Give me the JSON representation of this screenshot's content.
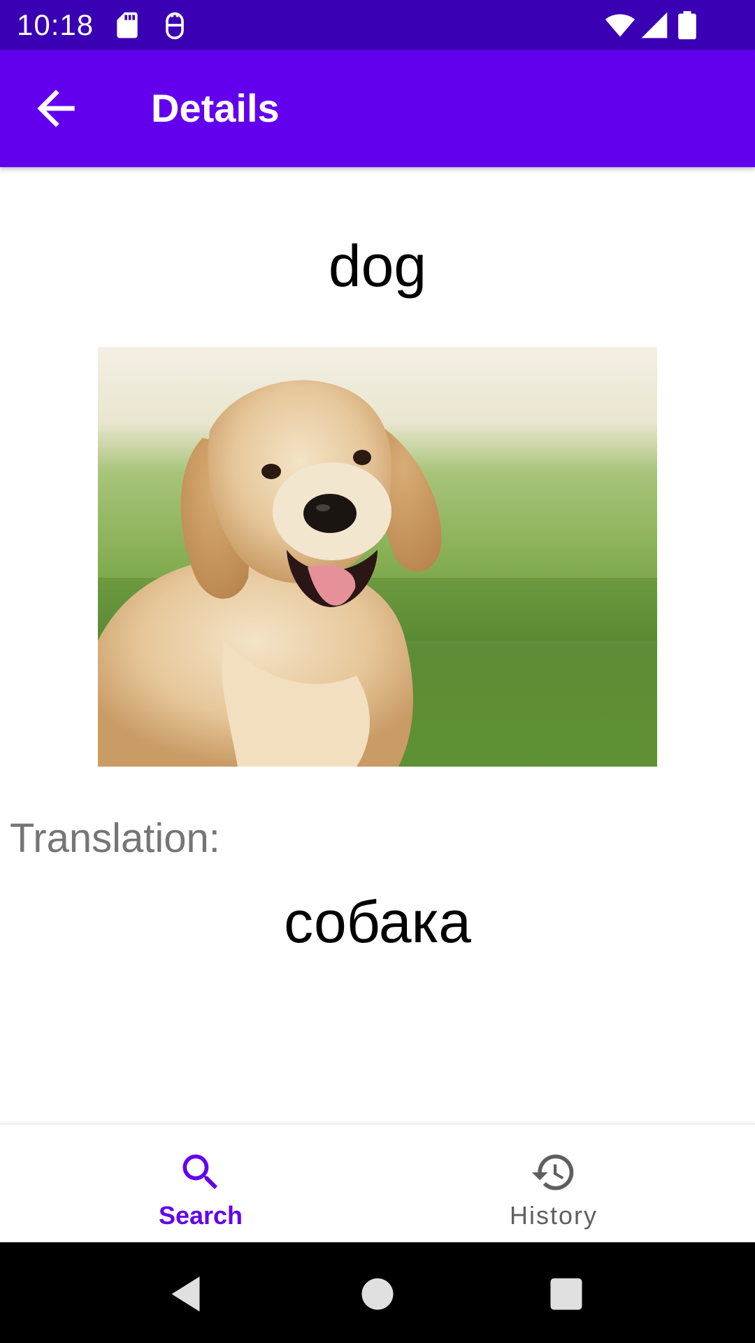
{
  "status_bar": {
    "time": "10:18",
    "icons": [
      "sd-card-icon",
      "android-debug-icon",
      "wifi-icon",
      "signal-icon",
      "battery-icon"
    ],
    "background": "#3a00b3"
  },
  "app_bar": {
    "title": "Details",
    "back_icon": "arrow-back-icon",
    "background": "#6200ee"
  },
  "content": {
    "word": "dog",
    "image_subject": "golden retriever",
    "translation_label": "Translation:",
    "translation": "собака"
  },
  "bottom_nav": {
    "items": [
      {
        "label": "Search",
        "icon": "search-icon",
        "selected": true
      },
      {
        "label": "History",
        "icon": "history-icon",
        "selected": false
      }
    ],
    "active_color": "#6200ee",
    "inactive_color": "#5f5f5f"
  },
  "system_nav": {
    "buttons": [
      "back-triangle-icon",
      "home-circle-icon",
      "recents-square-icon"
    ]
  }
}
